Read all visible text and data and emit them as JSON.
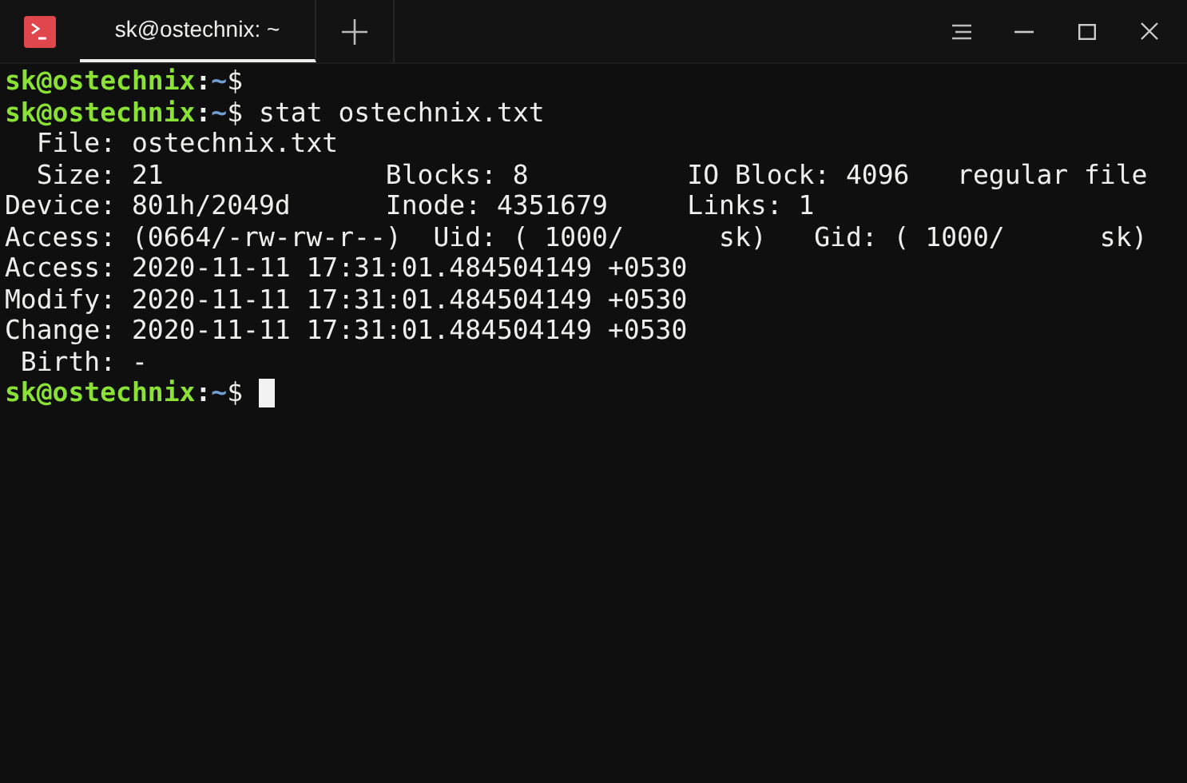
{
  "window": {
    "tabs": [
      {
        "label": "sk@ostechnix: ~",
        "selected": true
      }
    ]
  },
  "terminal": {
    "lines": [
      {
        "kind": "prompt",
        "user_host": "sk@ostechnix",
        "separator": ":",
        "path": "~",
        "symbol": "$",
        "cursor": false
      },
      {
        "kind": "prompt",
        "user_host": "sk@ostechnix",
        "separator": ":",
        "path": "~",
        "symbol": "$",
        "command": "stat ostechnix.txt",
        "cursor": false
      },
      {
        "kind": "output",
        "text": "  File: ostechnix.txt"
      },
      {
        "kind": "output",
        "text": "  Size: 21              Blocks: 8          IO Block: 4096   regular file"
      },
      {
        "kind": "output",
        "text": "Device: 801h/2049d      Inode: 4351679     Links: 1"
      },
      {
        "kind": "output",
        "text": "Access: (0664/-rw-rw-r--)  Uid: ( 1000/      sk)   Gid: ( 1000/      sk)"
      },
      {
        "kind": "output",
        "text": "Access: 2020-11-11 17:31:01.484504149 +0530"
      },
      {
        "kind": "output",
        "text": "Modify: 2020-11-11 17:31:01.484504149 +0530"
      },
      {
        "kind": "output",
        "text": "Change: 2020-11-11 17:31:01.484504149 +0530"
      },
      {
        "kind": "output",
        "text": " Birth: -"
      },
      {
        "kind": "prompt",
        "user_host": "sk@ostechnix",
        "separator": ":",
        "path": "~",
        "symbol": "$",
        "cursor": true
      }
    ]
  }
}
